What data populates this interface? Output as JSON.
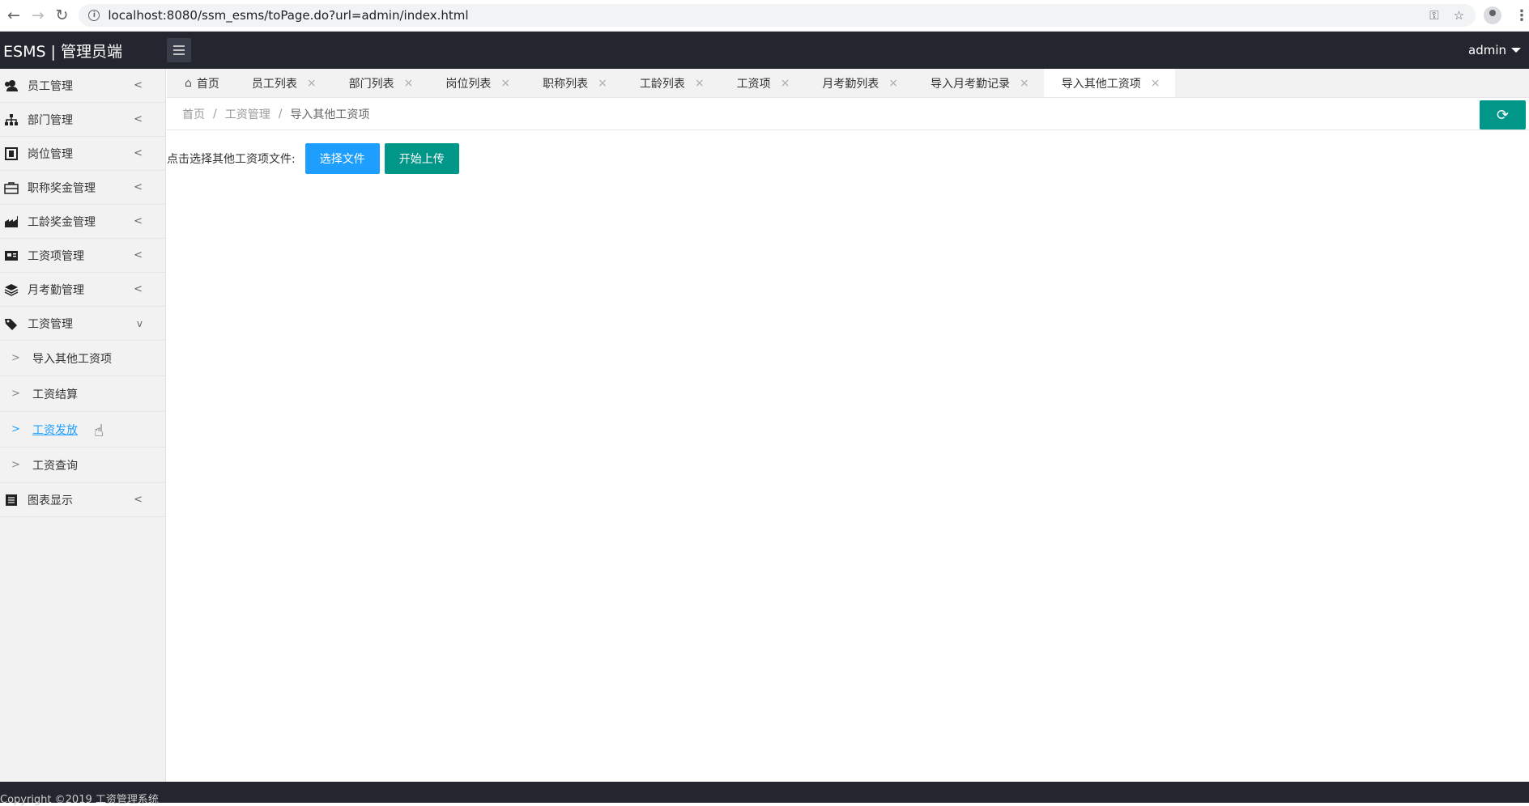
{
  "browser": {
    "url": "localhost:8080/ssm_esms/toPage.do?url=admin/index.html"
  },
  "header": {
    "logo": "ESMS | 管理员端",
    "user": "admin"
  },
  "sidebar": {
    "items": [
      {
        "label": "员工管理",
        "icon": "users-icon",
        "chevron": "<"
      },
      {
        "label": "部门管理",
        "icon": "sitemap-icon",
        "chevron": "<"
      },
      {
        "label": "岗位管理",
        "icon": "badge-icon",
        "chevron": "<"
      },
      {
        "label": "职称奖金管理",
        "icon": "briefcase-icon",
        "chevron": "<"
      },
      {
        "label": "工龄奖金管理",
        "icon": "industry-icon",
        "chevron": "<"
      },
      {
        "label": "工资项管理",
        "icon": "newspaper-icon",
        "chevron": "<"
      },
      {
        "label": "月考勤管理",
        "icon": "layers-icon",
        "chevron": "<"
      },
      {
        "label": "工资管理",
        "icon": "tags-icon",
        "chevron": "v"
      }
    ],
    "sub_items": [
      {
        "label": "导入其他工资项",
        "arrow": ">"
      },
      {
        "label": "工资结算",
        "arrow": ">"
      },
      {
        "label": "工资发放",
        "arrow": ">"
      },
      {
        "label": "工资查询",
        "arrow": ">"
      }
    ],
    "last_item": {
      "label": "图表显示",
      "icon": "list-icon",
      "chevron": "<"
    }
  },
  "tabs": [
    {
      "label": "首页"
    },
    {
      "label": "员工列表"
    },
    {
      "label": "部门列表"
    },
    {
      "label": "岗位列表"
    },
    {
      "label": "职称列表"
    },
    {
      "label": "工龄列表"
    },
    {
      "label": "工资项"
    },
    {
      "label": "月考勤列表"
    },
    {
      "label": "导入月考勤记录"
    },
    {
      "label": "导入其他工资项"
    }
  ],
  "tab_close": "×",
  "breadcrumb": {
    "home": "首页",
    "section": "工资管理",
    "current": "导入其他工资项",
    "sep": "/"
  },
  "upload": {
    "label": "点击选择其他工资项文件:",
    "choose_btn": "选择文件",
    "upload_btn": "开始上传"
  },
  "footer": {
    "copyright": "Copyright ©2019 工资管理系统"
  },
  "colors": {
    "header_bg": "#23262e",
    "accent_blue": "#1e9fff",
    "accent_green": "#009688"
  }
}
